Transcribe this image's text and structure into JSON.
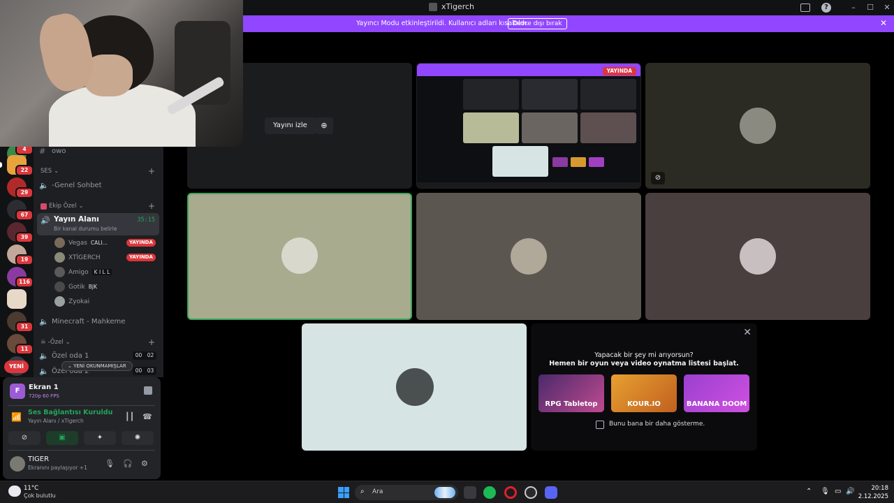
{
  "window": {
    "title": "xTigerch"
  },
  "banner": {
    "text": "Yayıncı Modu etkinleştirildi. Kullanıcı adları kısaltıldı.",
    "button": "Devre dışı bırak"
  },
  "servers": {
    "badges": [
      "4",
      "22",
      "29",
      "67",
      "39",
      "19",
      "116",
      "31",
      "11"
    ],
    "yeni": "YENİ"
  },
  "channels": {
    "owo": "owo",
    "ses_category": "SES",
    "genel": "-Genel Sohbet",
    "ekip_category": "Ekip Özel",
    "active": {
      "name": "Yayın Alanı",
      "status": "Bir kanal durumu belirle",
      "timer": "35:15"
    },
    "voice_users": [
      {
        "name": "Vegas",
        "tag": "CALI...",
        "live": "YAYINDA"
      },
      {
        "name": "XTİGERCH",
        "tag": "",
        "live": "YAYINDA"
      },
      {
        "name": "Amigo",
        "tag": "K I L L",
        "live": ""
      },
      {
        "name": "Gotik",
        "tag": "BJK",
        "live": ""
      },
      {
        "name": "Zyokai",
        "tag": "",
        "live": ""
      }
    ],
    "minecraft": "Minecraft - Mahkeme",
    "ozel_category": "-Özel",
    "ozel_oda_1": "Özel oda 1",
    "ozel_oda_1_counts": [
      "00",
      "02"
    ],
    "ozel_oda_2": "Özel oda 2",
    "ozel_oda_2_counts": [
      "00",
      "03"
    ],
    "unread": "YENİ OKUNMAMIŞLAR"
  },
  "panel": {
    "screen": {
      "letter": "F",
      "title": "Ekran 1",
      "quality": "720p 60 FPS"
    },
    "voice": {
      "status": "Ses Bağlantısı Kuruldu",
      "channel": "Yayın Alanı / xTigerch"
    },
    "user": {
      "name": "TIGER",
      "sub": "Ekranını paylaşıyor +1"
    }
  },
  "stage": {
    "watch_label": "Yayını izle",
    "live_label": "YAYINDA"
  },
  "activity": {
    "line1": "Yapacak bir şey mi arıyorsun?",
    "line2": "Hemen bir oyun veya video oynatma listesi başlat.",
    "games": [
      "RPG Tabletop",
      "KOUR.IO",
      "BANANA DOOM"
    ],
    "checkbox": "Bunu bana bir daha gösterme."
  },
  "taskbar": {
    "weather_temp": "11°C",
    "weather_desc": "Çok bulutlu",
    "search": "Ara",
    "time": "20:18",
    "date": "2.12.2025"
  },
  "colors": {
    "accent": "#9146ff",
    "live": "#da373c",
    "online": "#23a55a"
  }
}
